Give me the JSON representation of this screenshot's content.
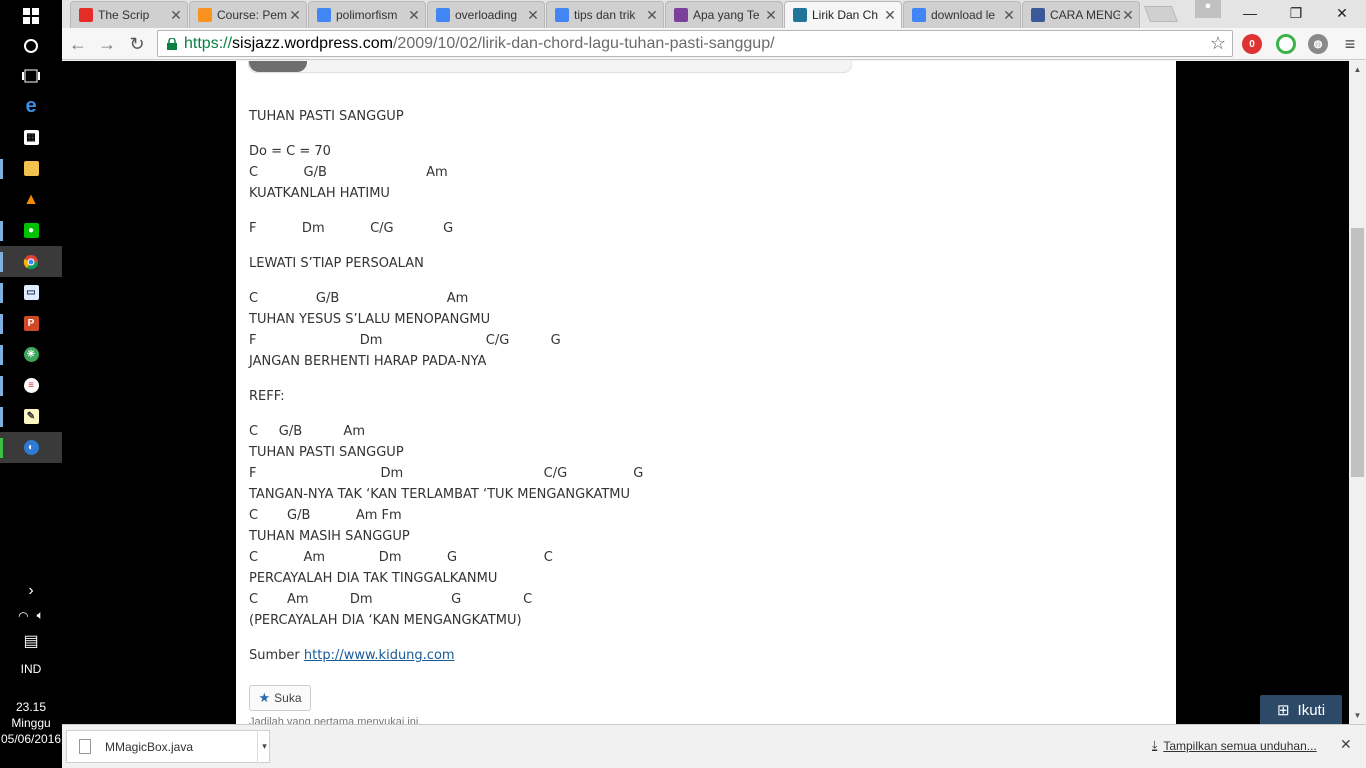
{
  "taskbar": {
    "time": "23.15",
    "day": "Minggu",
    "date": "05/06/2016",
    "language": "IND"
  },
  "tabs": [
    {
      "title": "The Scrip",
      "icon": "youtube-icon",
      "color": "#e52d27"
    },
    {
      "title": "Course: Pem",
      "icon": "moodle-icon",
      "color": "#f7931e"
    },
    {
      "title": "polimorfism",
      "icon": "google-icon",
      "color": "#4285f4"
    },
    {
      "title": "overloading",
      "icon": "google-icon",
      "color": "#4285f4"
    },
    {
      "title": "tips dan trik",
      "icon": "google-icon",
      "color": "#4285f4"
    },
    {
      "title": "Apa yang Te",
      "icon": "blog-icon",
      "color": "#7b3f9c"
    },
    {
      "title": "Lirik Dan Ch",
      "icon": "wordpress-icon",
      "color": "#21759b"
    },
    {
      "title": "download le",
      "icon": "google-icon",
      "color": "#4285f4"
    },
    {
      "title": "CARA MENG",
      "icon": "facebook-icon",
      "color": "#3b5998"
    }
  ],
  "address": {
    "scheme": "https://",
    "host": "sisjazz.wordpress.com",
    "path": "/2009/10/02/lirik-dan-chord-lagu-tuhan-pasti-sanggup/"
  },
  "post": {
    "lines": [
      "TUHAN PASTI SANGGUP",
      "",
      "Do = C = 70",
      "C           G/B                        Am",
      "KUATKANLAH HATIMU",
      "",
      "F           Dm           C/G            G",
      "",
      "LEWATI S’TIAP PERSOALAN",
      "",
      "C              G/B                          Am",
      "TUHAN YESUS S’LALU MENOPANGMU",
      "F                         Dm                         C/G          G",
      "JANGAN BERHENTI HARAP PADA-NYA",
      "",
      "REFF:",
      "",
      "C     G/B          Am",
      "TUHAN PASTI SANGGUP",
      "F                              Dm                                  C/G                G",
      "TANGAN-NYA TAK ‘KAN TERLAMBAT ‘TUK MENGANGKATMU",
      "C       G/B           Am Fm",
      "TUHAN MASIH SANGGUP",
      "C           Am             Dm           G                     C",
      "PERCAYALAH DIA TAK TINGGALKANMU",
      "C       Am          Dm                   G               C",
      "(PERCAYALAH DIA ‘KAN MENGANGKATMU)",
      ""
    ],
    "source_label": "Sumber",
    "source_link": "http://www.kidung.com",
    "like_label": "Suka",
    "first_like": "Jadilah yang pertama menyukai ini."
  },
  "follow_label": "Ikuti",
  "download_shelf": {
    "file": "MMagicBox.java",
    "show_all": "Tampilkan semua unduhan..."
  }
}
